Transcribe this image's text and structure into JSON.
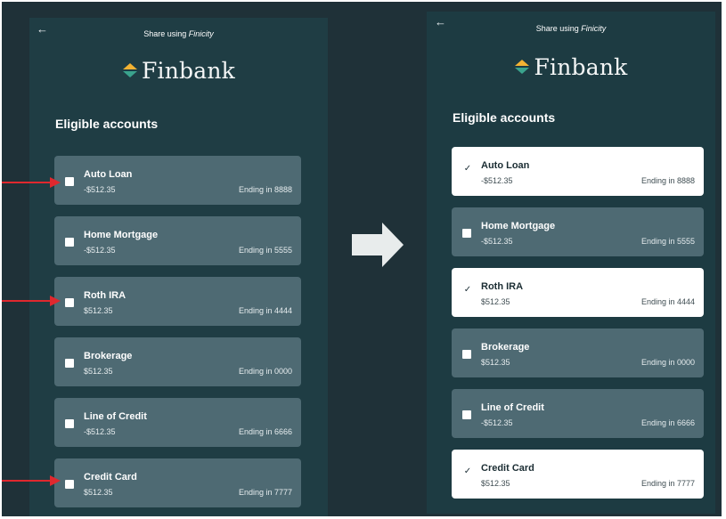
{
  "share_prefix": "Share using ",
  "share_brand": "Finicity",
  "bank_name": "Finbank",
  "section_title": "Eligible accounts",
  "back_icon": "←",
  "check_glyph": "✓",
  "colors": {
    "panel": "#1f3d44",
    "card_unselected": "#4e6a73",
    "card_selected": "#ffffff",
    "annotation_arrow": "#e0282e"
  },
  "before": {
    "accounts": [
      {
        "name": "Auto Loan",
        "balance": "-$512.35",
        "ending": "Ending in 8888",
        "selected": false
      },
      {
        "name": "Home Mortgage",
        "balance": "-$512.35",
        "ending": "Ending in 5555",
        "selected": false
      },
      {
        "name": "Roth IRA",
        "balance": "$512.35",
        "ending": "Ending in 4444",
        "selected": false
      },
      {
        "name": "Brokerage",
        "balance": "$512.35",
        "ending": "Ending in 0000",
        "selected": false
      },
      {
        "name": "Line of Credit",
        "balance": "-$512.35",
        "ending": "Ending in 6666",
        "selected": false
      },
      {
        "name": "Credit Card",
        "balance": "$512.35",
        "ending": "Ending in 7777",
        "selected": false
      }
    ]
  },
  "after": {
    "accounts": [
      {
        "name": "Auto Loan",
        "balance": "-$512.35",
        "ending": "Ending in 8888",
        "selected": true
      },
      {
        "name": "Home Mortgage",
        "balance": "-$512.35",
        "ending": "Ending in 5555",
        "selected": false
      },
      {
        "name": "Roth IRA",
        "balance": "$512.35",
        "ending": "Ending in 4444",
        "selected": true
      },
      {
        "name": "Brokerage",
        "balance": "$512.35",
        "ending": "Ending in 0000",
        "selected": false
      },
      {
        "name": "Line of Credit",
        "balance": "-$512.35",
        "ending": "Ending in 6666",
        "selected": false
      },
      {
        "name": "Credit Card",
        "balance": "$512.35",
        "ending": "Ending in 7777",
        "selected": true
      }
    ]
  }
}
